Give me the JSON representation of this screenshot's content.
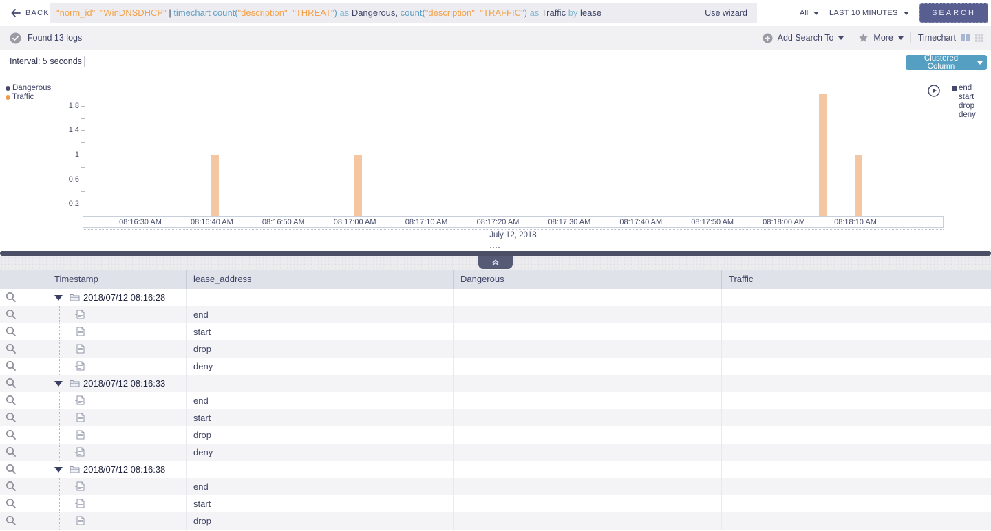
{
  "topbar": {
    "back_label": "BACK",
    "query_tokens": [
      {
        "text": "\"norm_id\"",
        "type": "string"
      },
      {
        "text": "=",
        "type": "plain"
      },
      {
        "text": "\"WinDNSDHCP\"",
        "type": "string"
      },
      {
        "text": " | ",
        "type": "plain"
      },
      {
        "text": "timechart ",
        "type": "keyword"
      },
      {
        "text": "count(",
        "type": "keyword"
      },
      {
        "text": "\"description\"",
        "type": "string"
      },
      {
        "text": "=",
        "type": "plain"
      },
      {
        "text": "\"THREAT\"",
        "type": "string"
      },
      {
        "text": ")",
        "type": "keyword"
      },
      {
        "text": " as ",
        "type": "modifier"
      },
      {
        "text": "Dangerous, ",
        "type": "plain"
      },
      {
        "text": "count(",
        "type": "keyword"
      },
      {
        "text": "\"description\"",
        "type": "string"
      },
      {
        "text": "=",
        "type": "plain"
      },
      {
        "text": "\"TRAFFIC\"",
        "type": "string"
      },
      {
        "text": ")",
        "type": "keyword"
      },
      {
        "text": " as ",
        "type": "modifier"
      },
      {
        "text": "Traffic ",
        "type": "plain"
      },
      {
        "text": "by ",
        "type": "modifier"
      },
      {
        "text": "lease",
        "type": "plain"
      }
    ],
    "use_wizard": "Use wizard",
    "scope_dropdown": "All",
    "time_dropdown": "LAST 10 MINUTES",
    "search_button": "SEARCH"
  },
  "toolbar": {
    "status": "Found 13 logs",
    "add_search_to": "Add Search To",
    "more": "More",
    "view_label": "Timechart"
  },
  "chart": {
    "interval_label": "Interval: 5 seconds",
    "chart_type_button": "Clustered Column"
  },
  "chart_data": {
    "type": "bar",
    "title": "",
    "x_ticks": [
      "08:16:30 AM",
      "08:16:40 AM",
      "08:16:50 AM",
      "08:17:00 AM",
      "08:17:10 AM",
      "08:17:20 AM",
      "08:17:30 AM",
      "08:17:40 AM",
      "08:17:50 AM",
      "08:18:00 AM",
      "08:18:10 AM"
    ],
    "y_ticks": [
      {
        "v": 1.8,
        "label": "1.8"
      },
      {
        "v": 1.4,
        "label": "1.4"
      },
      {
        "v": 1,
        "label": "1"
      },
      {
        "v": 0.6,
        "label": "0.6"
      },
      {
        "v": 0.2,
        "label": "0.2"
      }
    ],
    "ylim": [
      0,
      2.15
    ],
    "interval_seconds": 5,
    "date_label": "July 12, 2018",
    "series": [
      {
        "name": "Dangerous",
        "color": "#454a6d",
        "legend_color": "#454a6d",
        "points": []
      },
      {
        "name": "Traffic",
        "color": "#f4c6a2",
        "legend_color": "#ee9b4e",
        "points": [
          {
            "x": "08:16:40 AM",
            "y": 1
          },
          {
            "x": "08:17:00 AM",
            "y": 1
          },
          {
            "x": "08:18:05 AM",
            "y": 2
          },
          {
            "x": "08:18:10 AM",
            "y": 1
          }
        ]
      }
    ],
    "group_values": [
      "end",
      "start",
      "drop",
      "deny"
    ],
    "legend_position": "left"
  },
  "table": {
    "columns": [
      "Timestamp",
      "lease_address",
      "Dangerous",
      "Traffic"
    ],
    "rows": [
      {
        "kind": "group",
        "timestamp": "2018/07/12 08:16:28"
      },
      {
        "kind": "log",
        "lease_address": "end"
      },
      {
        "kind": "log",
        "lease_address": "start"
      },
      {
        "kind": "log",
        "lease_address": "drop"
      },
      {
        "kind": "log",
        "lease_address": "deny"
      },
      {
        "kind": "group",
        "timestamp": "2018/07/12 08:16:33"
      },
      {
        "kind": "log",
        "lease_address": "end"
      },
      {
        "kind": "log",
        "lease_address": "start"
      },
      {
        "kind": "log",
        "lease_address": "drop"
      },
      {
        "kind": "log",
        "lease_address": "deny"
      },
      {
        "kind": "group",
        "timestamp": "2018/07/12 08:16:38"
      },
      {
        "kind": "log",
        "lease_address": "end"
      },
      {
        "kind": "log",
        "lease_address": "start"
      },
      {
        "kind": "log",
        "lease_address": "drop"
      }
    ]
  }
}
